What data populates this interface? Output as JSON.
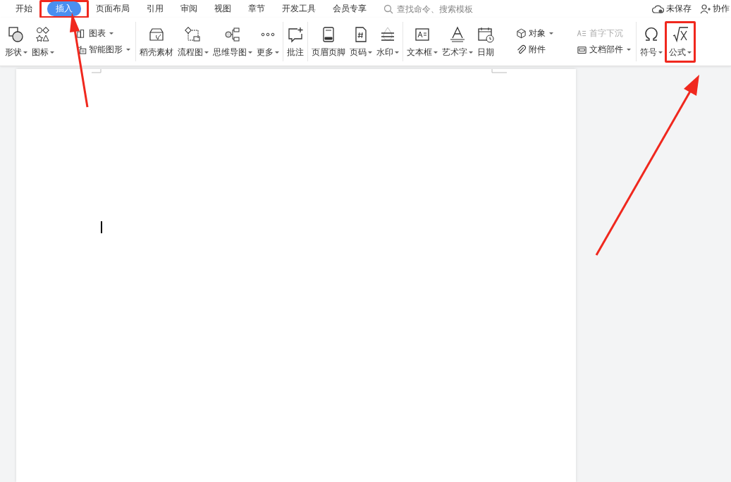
{
  "menu_tabs": [
    {
      "label": "开始",
      "selected": false,
      "highlighted": false
    },
    {
      "label": "插入",
      "selected": true,
      "highlighted": true
    },
    {
      "label": "页面布局",
      "selected": false,
      "highlighted": false
    },
    {
      "label": "引用",
      "selected": false,
      "highlighted": false
    },
    {
      "label": "审阅",
      "selected": false,
      "highlighted": false
    },
    {
      "label": "视图",
      "selected": false,
      "highlighted": false
    },
    {
      "label": "章节",
      "selected": false,
      "highlighted": false
    },
    {
      "label": "开发工具",
      "selected": false,
      "highlighted": false
    },
    {
      "label": "会员专享",
      "selected": false,
      "highlighted": false
    }
  ],
  "search": {
    "placeholder": "查找命令、搜索模板"
  },
  "status_items": [
    {
      "label": "未保存"
    },
    {
      "label": "协作"
    }
  ],
  "ribbon": {
    "groups": [
      {
        "items": [
          {
            "kind": "large",
            "label": "形状",
            "dropdown": true,
            "highlighted": false
          },
          {
            "kind": "large",
            "label": "图标",
            "dropdown": true,
            "highlighted": false
          },
          {
            "kind": "stack",
            "items": [
              {
                "label": "图表",
                "dropdown": true,
                "disabled": false
              },
              {
                "label": "智能图形",
                "dropdown": true,
                "disabled": false
              }
            ]
          }
        ]
      },
      {
        "items": [
          {
            "kind": "large",
            "label": "稻壳素材",
            "dropdown": false,
            "highlighted": false
          },
          {
            "kind": "large",
            "label": "流程图",
            "dropdown": true,
            "highlighted": false
          },
          {
            "kind": "large",
            "label": "思维导图",
            "dropdown": true,
            "highlighted": false
          },
          {
            "kind": "large",
            "label": "更多",
            "dropdown": true,
            "highlighted": false
          }
        ]
      },
      {
        "items": [
          {
            "kind": "large",
            "label": "批注",
            "dropdown": false,
            "highlighted": false
          }
        ]
      },
      {
        "items": [
          {
            "kind": "large",
            "label": "页眉页脚",
            "dropdown": false,
            "highlighted": false
          },
          {
            "kind": "large",
            "label": "页码",
            "dropdown": true,
            "highlighted": false
          },
          {
            "kind": "large",
            "label": "水印",
            "dropdown": true,
            "highlighted": false
          }
        ]
      },
      {
        "items": [
          {
            "kind": "large",
            "label": "文本框",
            "dropdown": true,
            "highlighted": false
          },
          {
            "kind": "large",
            "label": "艺术字",
            "dropdown": true,
            "highlighted": false
          },
          {
            "kind": "large",
            "label": "日期",
            "dropdown": false,
            "highlighted": false
          },
          {
            "kind": "stack",
            "items": [
              {
                "label": "对象",
                "dropdown": true,
                "disabled": false
              },
              {
                "label": "附件",
                "dropdown": false,
                "disabled": false
              }
            ]
          },
          {
            "kind": "stack",
            "items": [
              {
                "label": "首字下沉",
                "dropdown": false,
                "disabled": true
              },
              {
                "label": "文档部件",
                "dropdown": true,
                "disabled": false
              }
            ]
          }
        ]
      },
      {
        "items": [
          {
            "kind": "large",
            "label": "符号",
            "dropdown": true,
            "highlighted": false
          },
          {
            "kind": "large",
            "label": "公式",
            "dropdown": true,
            "highlighted": true
          }
        ]
      }
    ]
  }
}
